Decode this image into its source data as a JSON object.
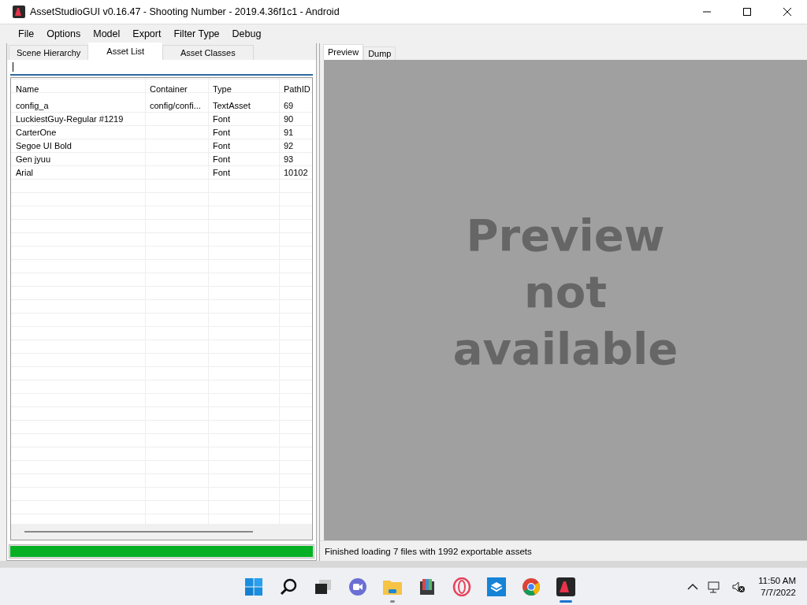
{
  "window": {
    "title": "AssetStudioGUI v0.16.47 - Shooting Number - 2019.4.36f1c1 - Android"
  },
  "menu": [
    "File",
    "Options",
    "Model",
    "Export",
    "Filter Type",
    "Debug"
  ],
  "left_tabs": [
    {
      "label": "Scene Hierarchy",
      "selected": false
    },
    {
      "label": "Asset List",
      "selected": true
    },
    {
      "label": "Asset Classes",
      "selected": false
    }
  ],
  "table": {
    "columns": [
      "Name",
      "Container",
      "Type",
      "PathID"
    ],
    "rows": [
      [
        "config_a",
        "config/confi...",
        "TextAsset",
        "69"
      ],
      [
        "LuckiestGuy-Regular #1219",
        "",
        "Font",
        "90"
      ],
      [
        "CarterOne",
        "",
        "Font",
        "91"
      ],
      [
        "Segoe UI Bold",
        "",
        "Font",
        "92"
      ],
      [
        "Gen jyuu",
        "",
        "Font",
        "93"
      ],
      [
        "Arial",
        "",
        "Font",
        "10102"
      ]
    ]
  },
  "progress": {
    "level": 1
  },
  "right_tabs": [
    {
      "label": "Preview",
      "selected": true
    },
    {
      "label": "Dump",
      "selected": false
    }
  ],
  "preview": {
    "message": "Preview not available"
  },
  "status_bar": "Finished loading 7 files with 1992 exportable assets",
  "taskbar": {
    "apps": [
      {
        "kind": "start",
        "running": false,
        "selected": false
      },
      {
        "kind": "search",
        "running": false,
        "selected": false
      },
      {
        "kind": "taskview",
        "running": false,
        "selected": false
      },
      {
        "kind": "chat",
        "running": false,
        "selected": false
      },
      {
        "kind": "folder",
        "running": true,
        "selected": false
      },
      {
        "kind": "archive",
        "running": false,
        "selected": false
      },
      {
        "kind": "opera",
        "running": false,
        "selected": false
      },
      {
        "kind": "box",
        "running": false,
        "selected": false
      },
      {
        "kind": "chrome",
        "running": false,
        "selected": false
      },
      {
        "kind": "assetstudio",
        "running": true,
        "selected": true
      }
    ],
    "time": "11:50 AM",
    "date": "7/7/2022"
  }
}
